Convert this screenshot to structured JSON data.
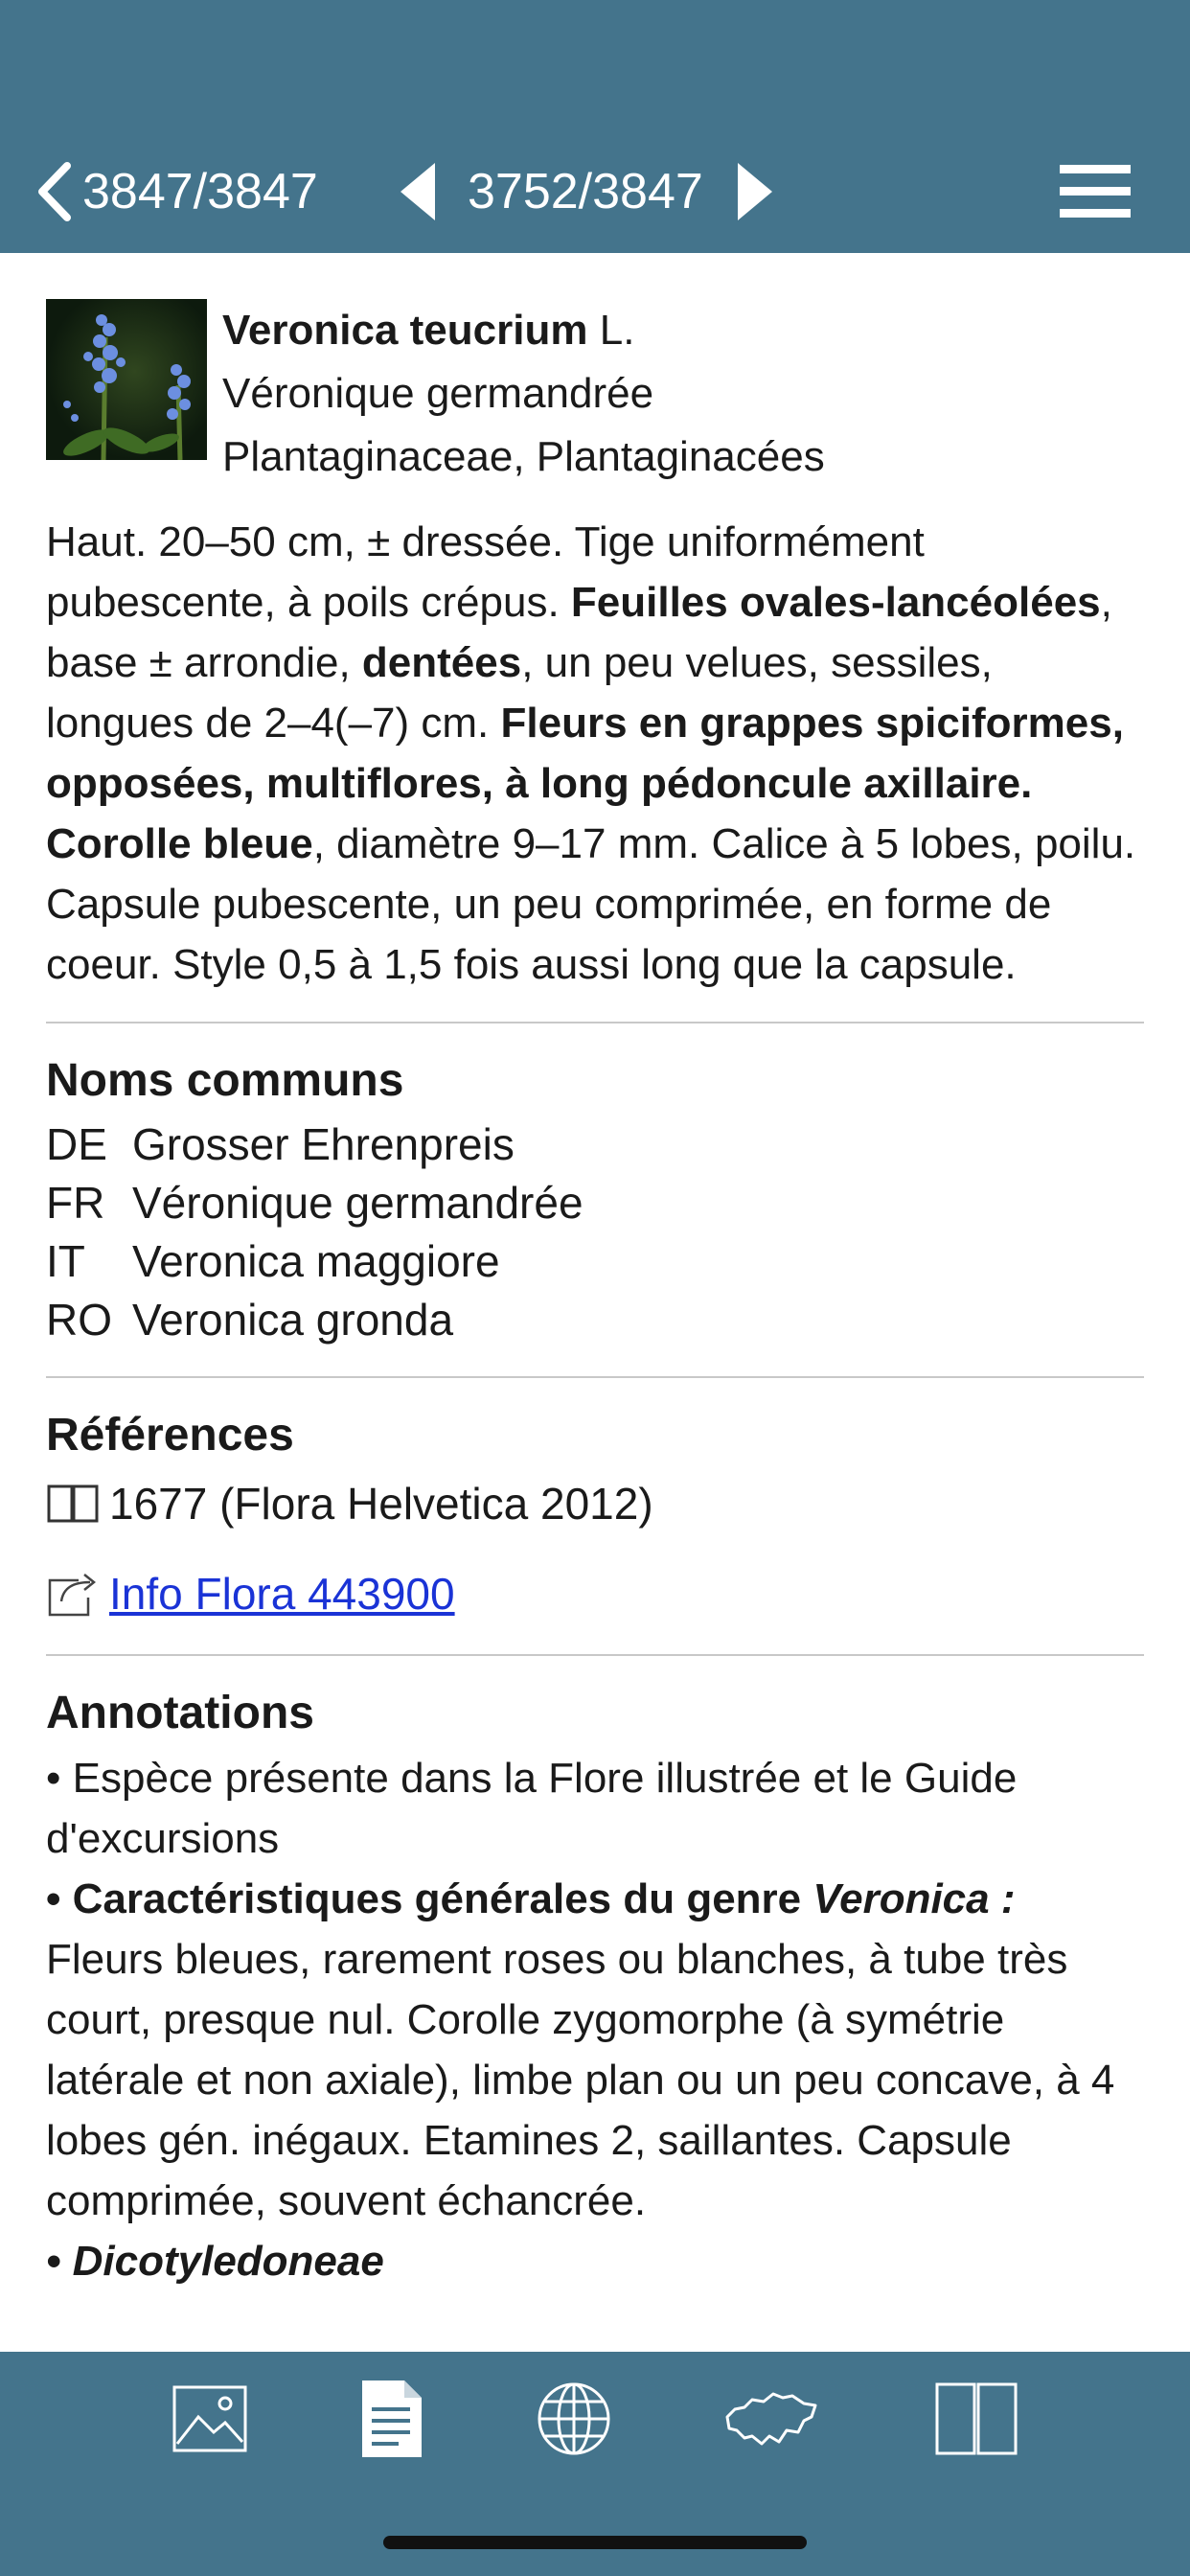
{
  "nav": {
    "back_counter": "3847/3847",
    "record_counter": "3752/3847"
  },
  "species": {
    "latin_name": "Veronica teucrium",
    "author": "L.",
    "common_name": "Véronique germandrée",
    "family": "Plantaginaceae, Plantaginacées"
  },
  "description": {
    "segments": [
      {
        "text": "Haut. 20–50 cm, ± dressée. Tige uniformément pubescente, à poils crépus. ",
        "bold": false
      },
      {
        "text": "Feuilles ovales-lancéolées",
        "bold": true
      },
      {
        "text": ", base ± arrondie, ",
        "bold": false
      },
      {
        "text": "dentées",
        "bold": true
      },
      {
        "text": ", un peu velues, sessiles, longues de 2–4(–7) cm. ",
        "bold": false
      },
      {
        "text": "Fleurs en grappes spiciformes, opposées, multiflores, à long pédoncule axillaire. Corolle bleue",
        "bold": true
      },
      {
        "text": ", diamètre 9–17 mm. Calice à 5 lobes, poilu. Capsule pubescente, un peu comprimée, en forme de coeur. Style 0,5 à 1,5 fois aussi long que la capsule.",
        "bold": false
      }
    ]
  },
  "common_names": {
    "title": "Noms communs",
    "rows": [
      {
        "lang": "DE",
        "name": "Grosser Ehrenpreis"
      },
      {
        "lang": "FR",
        "name": "Véronique germandrée"
      },
      {
        "lang": "IT",
        "name": "Veronica maggiore"
      },
      {
        "lang": "RO",
        "name": "Veronica gronda"
      }
    ]
  },
  "references": {
    "title": "Références",
    "book_ref": "1677 (Flora Helvetica 2012)",
    "link_label": "Info Flora 443900"
  },
  "annotations": {
    "title": "Annotations",
    "item1": "• Espèce présente dans la Flore illustrée et le Guide d'excursions",
    "item2_prefix": "• Caractéristiques générales du genre ",
    "item2_genus": "Veronica :",
    "item2_text": "Fleurs bleues, rarement roses ou blanches, à tube très court, presque nul. Corolle zygomorphe (à symétrie latérale et non axiale), limbe plan ou un peu concave, à 4 lobes gén. inégaux. Etamines 2, saillantes. Capsule comprimée, souvent échancrée.",
    "item3_partial": "• Dicotyledoneae"
  },
  "tabs": [
    {
      "name": "image-icon"
    },
    {
      "name": "document-icon",
      "selected": true
    },
    {
      "name": "globe-icon"
    },
    {
      "name": "switzerland-map-icon"
    },
    {
      "name": "book-icon"
    }
  ],
  "colors": {
    "bar": "#44748c",
    "link": "#1a33d6"
  }
}
